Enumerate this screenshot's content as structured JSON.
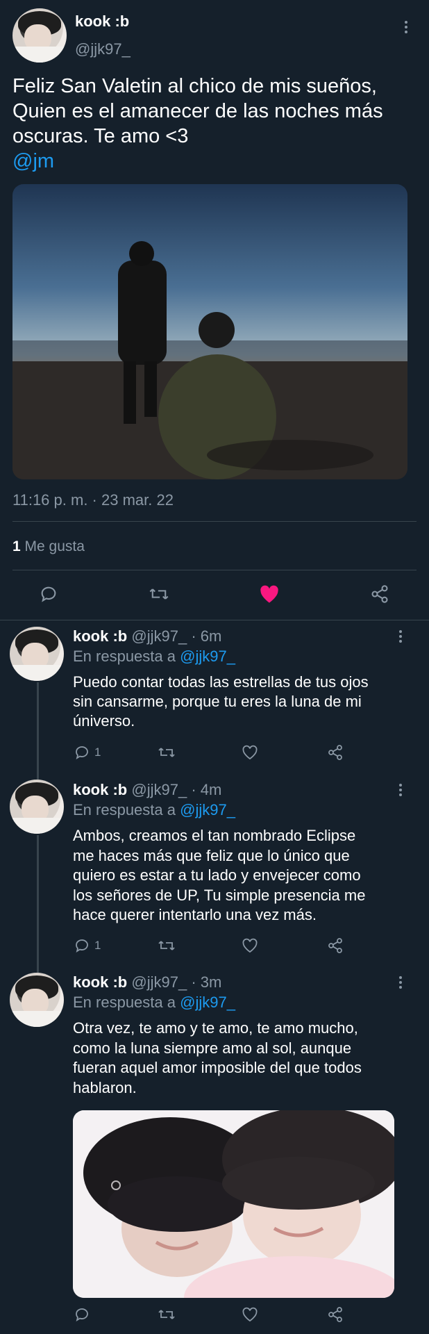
{
  "main_tweet": {
    "author_name": "kook :b",
    "author_handle": "@jjk97_",
    "text_line1": "Feliz San Valetin al chico de mis sueños,",
    "text_line2": "Quien es el amanecer de las noches más",
    "text_line3": "oscuras. Te amo <3",
    "mention": "@jm",
    "timestamp": "11:16 p. m. · 23 mar. 22",
    "likes_count": "1",
    "likes_label": "Me gusta"
  },
  "replies": [
    {
      "author_name": "kook :b",
      "author_handle": "@jjk97_",
      "time": "· 6m",
      "reply_label": "En respuesta a",
      "reply_to": "@jjk97_",
      "lines": [
        "Puedo contar todas las estrellas de tus ojos",
        "sin cansarme, porque tu eres la luna de mi",
        "úniverso."
      ],
      "reply_count": "1"
    },
    {
      "author_name": "kook :b",
      "author_handle": "@jjk97_",
      "time": "· 4m",
      "reply_label": "En respuesta a",
      "reply_to": "@jjk97_",
      "lines": [
        "Ambos, creamos el tan nombrado Eclipse",
        "me haces más que feliz que lo único que",
        "quiero es estar a tu lado y envejecer como",
        "los señores de UP, Tu simple presencia me",
        "hace querer intentarlo una vez más."
      ],
      "reply_count": "1"
    },
    {
      "author_name": "kook :b",
      "author_handle": "@jjk97_",
      "time": "· 3m",
      "reply_label": "En respuesta a",
      "reply_to": "@jjk97_",
      "lines": [
        "Otra vez, te amo y te amo, te amo mucho,",
        "como la luna siempre amo al sol, aunque",
        "fueran aquel amor imposible del que todos",
        "hablaron."
      ],
      "reply_count": ""
    }
  ],
  "colors": {
    "background": "#15202b",
    "text": "#ffffff",
    "muted": "#8b98a5",
    "link": "#1d9bf0",
    "like": "#f91880",
    "divider": "#38444d"
  },
  "icons": [
    "more-icon",
    "reply-icon",
    "retweet-icon",
    "like-icon",
    "share-icon"
  ]
}
